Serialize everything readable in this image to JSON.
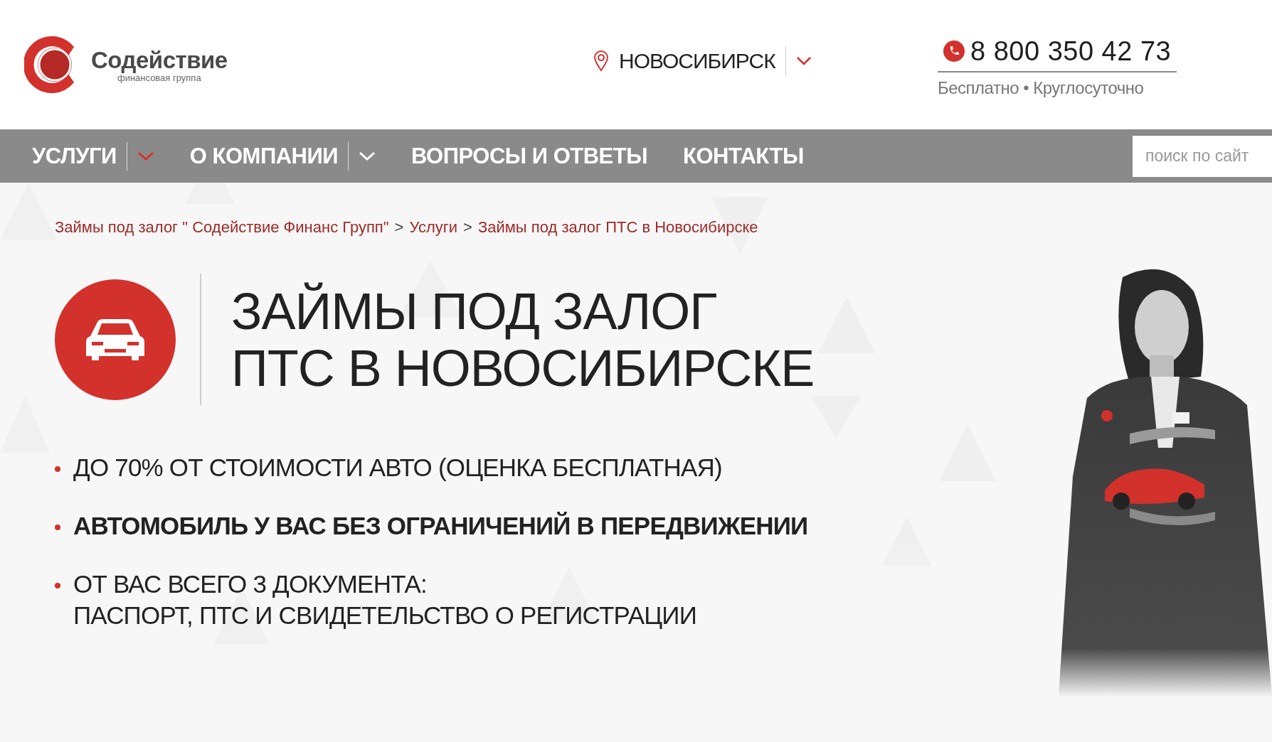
{
  "logo": {
    "name": "Содействие",
    "tagline": "финансовая группа"
  },
  "city": {
    "name": "НОВОСИБИРСК"
  },
  "phone": {
    "number": "8 800 350 42 73",
    "note": "Бесплатно • Круглосуточно"
  },
  "nav": [
    {
      "label": "УСЛУГИ",
      "dropdown": {
        "active": true
      }
    },
    {
      "label": "О КОМПАНИИ",
      "dropdown": {
        "active": false
      }
    },
    {
      "label": "ВОПРОСЫ И ОТВЕТЫ"
    },
    {
      "label": "КОНТАКТЫ"
    }
  ],
  "search": {
    "placeholder": "поиск по сайт"
  },
  "breadcrumb": {
    "separator": ">",
    "items": [
      "Займы под залог \" Содействие Финанс Групп\"",
      "Услуги",
      "Займы под залог ПТС в Новосибирске"
    ]
  },
  "title": {
    "lines": [
      "ЗАЙМЫ ПОД ЗАЛОГ",
      "ПТС В НОВОСИБИРСКЕ"
    ]
  },
  "bullets": [
    {
      "lines": [
        "ДО 70% ОТ СТОИМОСТИ АВТО (ОЦЕНКА БЕСПЛАТНАЯ)"
      ],
      "bold": false
    },
    {
      "lines": [
        "АВТОМОБИЛЬ У ВАС БЕЗ ОГРАНИЧЕНИЙ В ПЕРЕДВИЖЕНИИ"
      ],
      "bold": true
    },
    {
      "lines": [
        "ОТ ВАС ВСЕГО 3 ДОКУМЕНТА:",
        "ПАСПОРТ, ПТС И СВИДЕТЕЛЬСТВО О РЕГИСТРАЦИИ"
      ],
      "bold": false
    }
  ]
}
